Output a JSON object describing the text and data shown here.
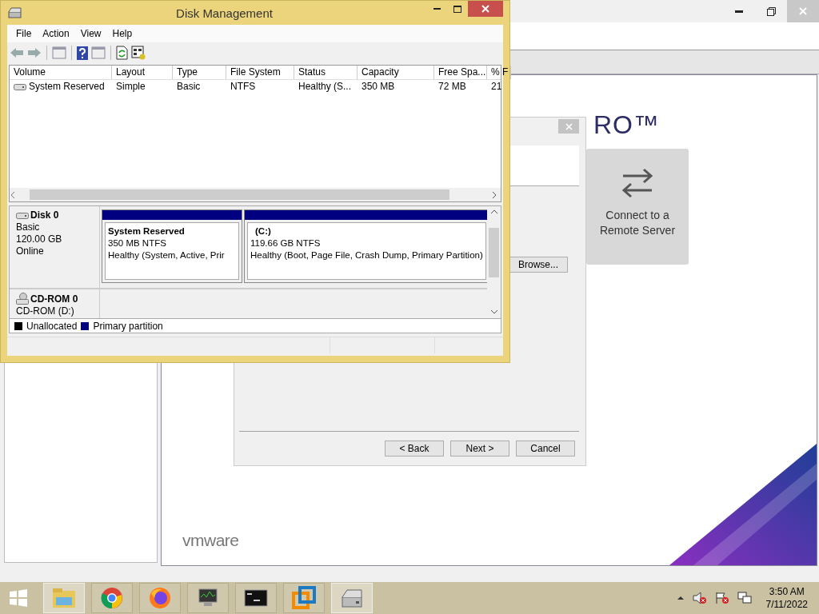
{
  "vmware_window": {
    "logo_fragment": "RO™",
    "brand": "vmware",
    "connect_card": {
      "label": "Connect to a Remote Server"
    }
  },
  "wizard_dialog": {
    "browse_button": "Browse...",
    "buttons": [
      "< Back",
      "Next >",
      "Cancel"
    ]
  },
  "disk_management": {
    "title": "Disk Management",
    "menu": [
      "File",
      "Action",
      "View",
      "Help"
    ],
    "volume_table": {
      "columns": [
        "Volume",
        "Layout",
        "Type",
        "File System",
        "Status",
        "Capacity",
        "Free Spa...",
        "% F"
      ],
      "rows": [
        {
          "cells": [
            "System Reserved",
            "Simple",
            "Basic",
            "NTFS",
            "Healthy (S...",
            "350 MB",
            "72 MB",
            "21"
          ]
        }
      ]
    },
    "disks": [
      {
        "kind": "disk",
        "name": "Disk 0",
        "lines": [
          "Basic",
          "120.00 GB",
          "Online"
        ],
        "partitions": [
          {
            "name": "System Reserved",
            "size": "350 MB NTFS",
            "status": "Healthy (System, Active, Prir"
          },
          {
            "name": "(C:)",
            "size": "119.66 GB NTFS",
            "status": "Healthy (Boot, Page File, Crash Dump, Primary Partition)"
          }
        ]
      },
      {
        "kind": "cdrom",
        "name": "CD-ROM 0",
        "lines": [
          "CD-ROM (D:)"
        ]
      }
    ],
    "legend": [
      {
        "label": "Unallocated",
        "color": "#000000"
      },
      {
        "label": "Primary partition",
        "color": "#000080"
      }
    ]
  },
  "taskbar": {
    "apps": [
      {
        "kind": "explorer",
        "active": true
      },
      {
        "kind": "chrome",
        "active": false
      },
      {
        "kind": "firefox",
        "active": false
      },
      {
        "kind": "monitor",
        "active": false
      },
      {
        "kind": "console",
        "active": false
      },
      {
        "kind": "vmware",
        "active": false
      },
      {
        "kind": "drive",
        "active": true
      }
    ],
    "time": "3:50 AM",
    "date": "7/11/2022"
  }
}
